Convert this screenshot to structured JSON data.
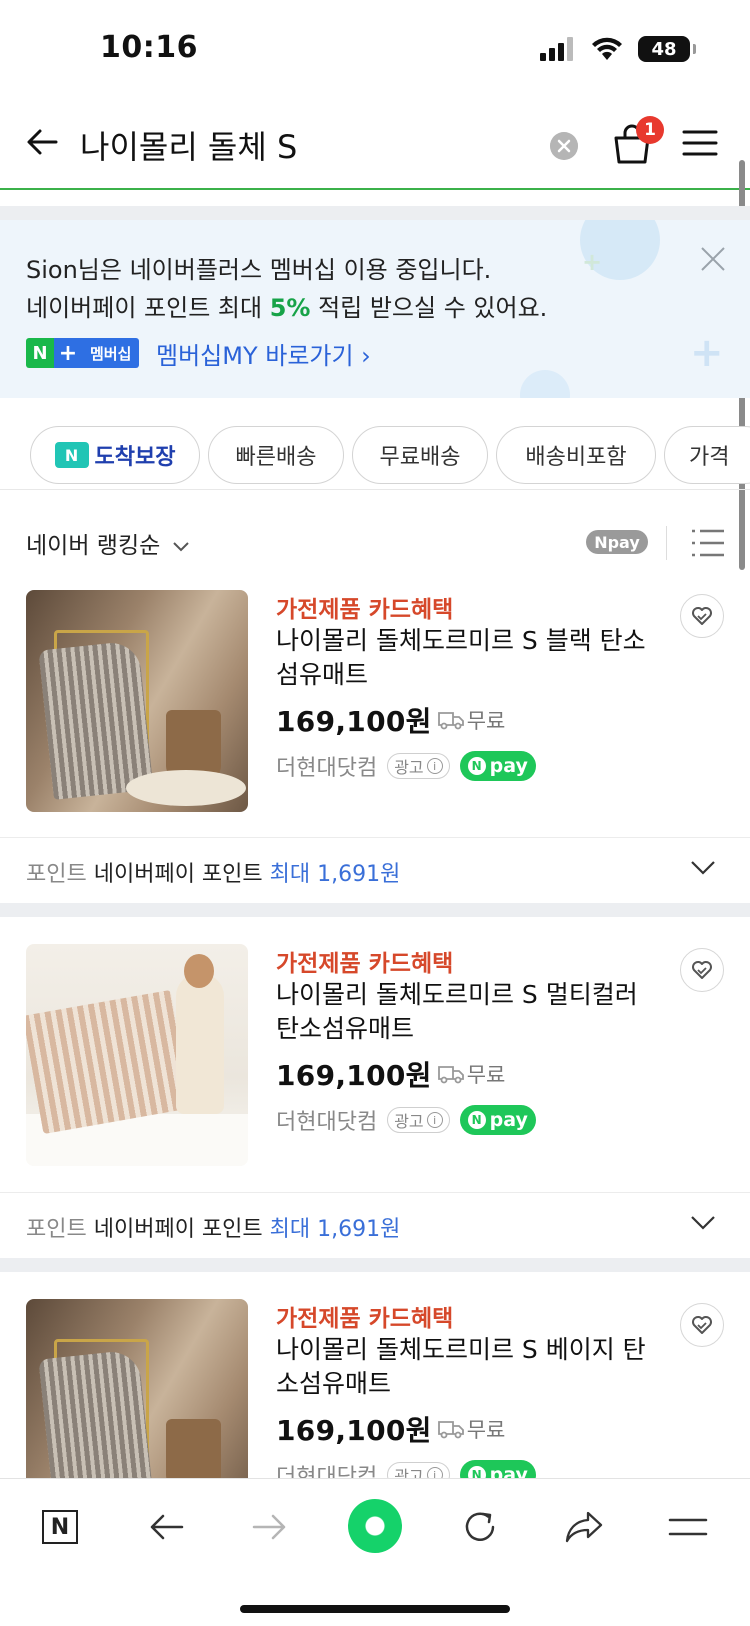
{
  "status_bar": {
    "time": "10:16",
    "battery": "48"
  },
  "header": {
    "query": "나이몰리 돌체 S",
    "cart_count": "1"
  },
  "membership": {
    "line1_user": "Sion",
    "line1_rest": "님은 네이버플러스 멤버십 이용 중입니다.",
    "line2_pre": "네이버페이 포인트 최대 ",
    "line2_rate": "5%",
    "line2_post": " 적립 받으실 수 있어요.",
    "badge_n": "N",
    "badge_plus": "+",
    "badge_text": "멤버십",
    "link": "멤버십MY 바로가기 ›"
  },
  "filters": {
    "guarantee_icon": "N",
    "guarantee_label": "도착보장",
    "chips": [
      "빠른배송",
      "무료배송",
      "배송비포함",
      "가격"
    ]
  },
  "sort": {
    "label": "네이버 랭킹순",
    "npay_label": "Npay"
  },
  "products": [
    {
      "benefit": "가전제품 카드혜택",
      "title": "나이몰리 돌체도르미르 S 블랙 탄소섬유매트",
      "price": "169,100원",
      "shipping": "무료",
      "seller": "더현대닷컴",
      "ad": "광고",
      "npay": "pay",
      "points_label": "포인트",
      "points_text": "네이버페이 포인트",
      "points_value": "최대 1,691원"
    },
    {
      "benefit": "가전제품 카드혜택",
      "title": "나이몰리 돌체도르미르 S 멀티컬러 탄소섬유매트",
      "price": "169,100원",
      "shipping": "무료",
      "seller": "더현대닷컴",
      "ad": "광고",
      "npay": "pay",
      "points_label": "포인트",
      "points_text": "네이버페이 포인트",
      "points_value": "최대 1,691원"
    },
    {
      "benefit": "가전제품 카드혜택",
      "title": "나이몰리 돌체도르미르 S 베이지 탄소섬유매트",
      "price": "169,100원",
      "shipping": "무료",
      "seller": "더현대닷컴",
      "ad": "광고",
      "npay": "pay"
    }
  ],
  "bottom_bar": {
    "naver_label": "N"
  },
  "colors": {
    "accent_green": "#1ec759",
    "benefit_red": "#d6482a",
    "link_blue": "#2a62d8"
  }
}
